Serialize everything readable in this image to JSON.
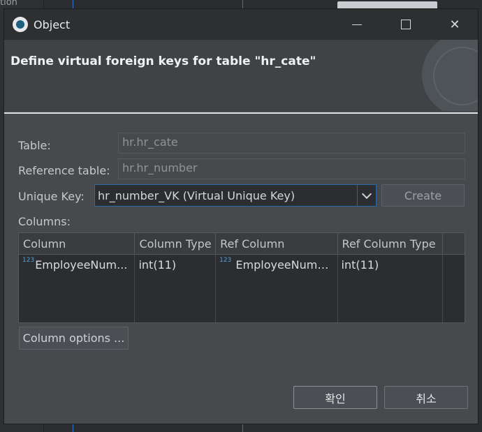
{
  "background": {
    "left_text": "tion"
  },
  "window": {
    "title": "Object"
  },
  "header": {
    "title": "Define virtual foreign keys for table \"hr_cate\""
  },
  "form": {
    "table_label": "Table:",
    "table_value": "hr.hr_cate",
    "ref_table_label": "Reference table:",
    "ref_table_value": "hr.hr_number",
    "unique_key_label": "Unique Key:",
    "unique_key_value": "hr_number_VK (Virtual Unique Key)",
    "create_label": "Create",
    "columns_label": "Columns:"
  },
  "table": {
    "headers": [
      "Column",
      "Column Type",
      "Ref Column",
      "Ref Column Type",
      ""
    ],
    "rows": [
      {
        "column": "EmployeeNum...",
        "column_type": "int(11)",
        "ref_column": "EmployeeNumb...",
        "ref_column_type": "int(11)",
        "type_icon": "123"
      }
    ]
  },
  "buttons": {
    "column_options": "Column options ...",
    "ok": "확인",
    "cancel": "취소"
  },
  "colors": {
    "accent": "#2a6aa8",
    "type_icon": "#4aa3e0"
  }
}
